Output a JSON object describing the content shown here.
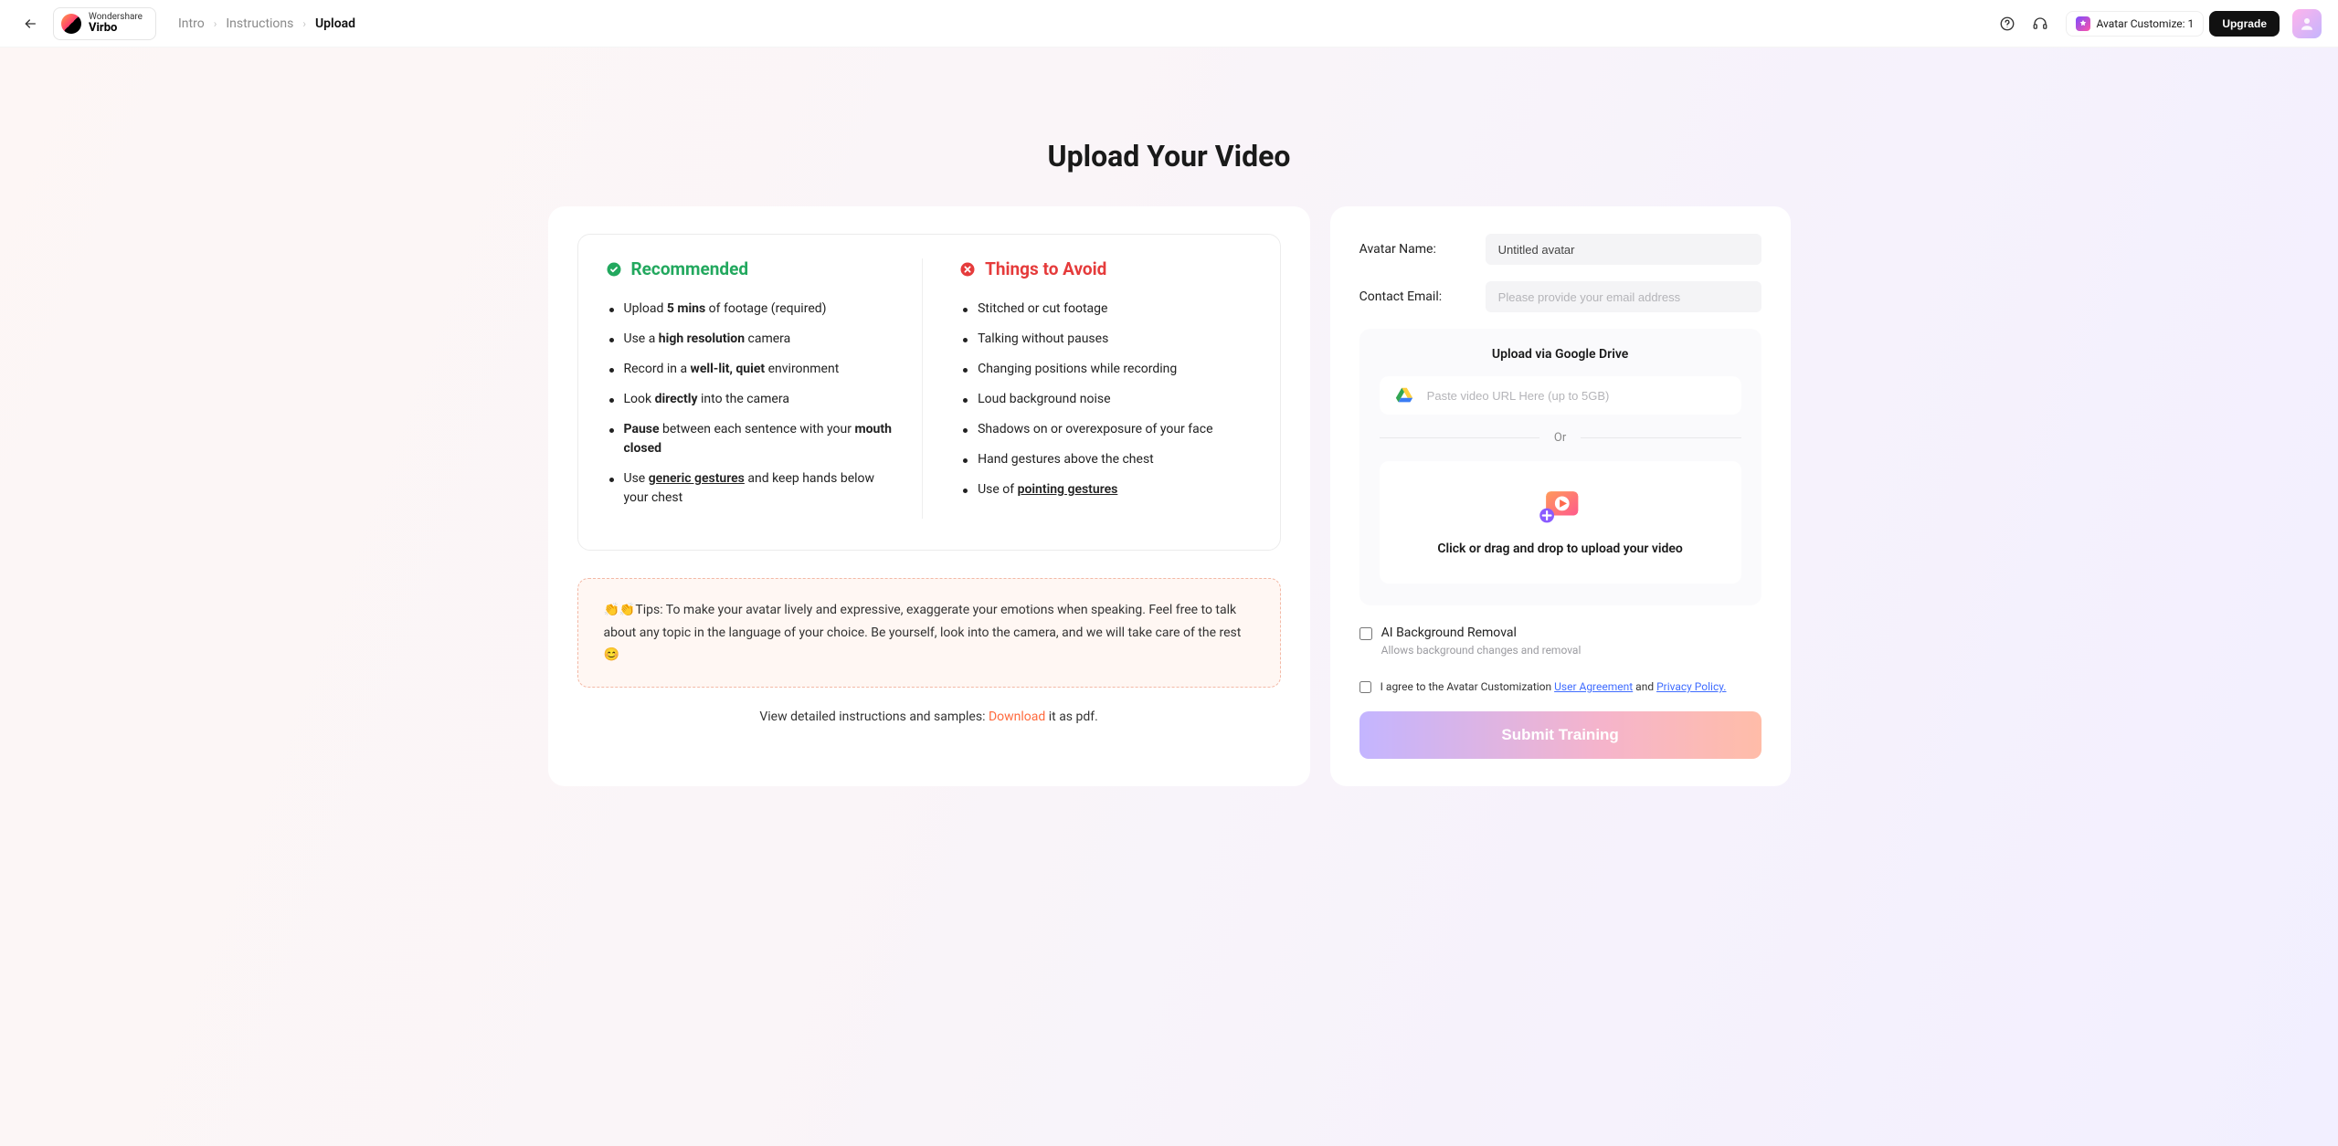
{
  "brand": {
    "top": "Wondershare",
    "bottom": "Virbo"
  },
  "breadcrumb": [
    {
      "label": "Intro",
      "current": false
    },
    {
      "label": "Instructions",
      "current": false
    },
    {
      "label": "Upload",
      "current": true
    }
  ],
  "header": {
    "avatar_customize_label": "Avatar Customize: 1",
    "upgrade": "Upgrade"
  },
  "page": {
    "title": "Upload Your Video"
  },
  "guidelines": {
    "recommended": {
      "heading": "Recommended",
      "items": [
        {
          "html": "Upload <strong>5 mins</strong> of footage (required)"
        },
        {
          "html": "Use a <strong>high resolution</strong> camera"
        },
        {
          "html": "Record in a <strong>well-lit, quiet</strong> environment"
        },
        {
          "html": "Look <strong>directly</strong> into the camera"
        },
        {
          "html": "<strong>Pause</strong> between each sentence with your <strong>mouth closed</strong>"
        },
        {
          "html": "Use <span class='bul'>generic gestures</span> and keep hands below your chest"
        }
      ]
    },
    "avoid": {
      "heading": "Things to Avoid",
      "items": [
        {
          "html": "Stitched or cut footage"
        },
        {
          "html": "Talking without pauses"
        },
        {
          "html": "Changing positions while recording"
        },
        {
          "html": "Loud background noise"
        },
        {
          "html": "Shadows on or overexposure of your face"
        },
        {
          "html": "Hand gestures above the chest"
        },
        {
          "html": "Use of <span class='bul'>pointing gestures</span>"
        }
      ]
    }
  },
  "tips": {
    "text": "👏👏Tips: To make your avatar lively and expressive, exaggerate your emotions when speaking. Feel free to talk about any topic in the language of your choice. Be yourself, look into the camera, and we will take care of the rest 😊"
  },
  "download": {
    "prefix": "View detailed instructions and samples: ",
    "link": "Download",
    "suffix": " it as pdf."
  },
  "form": {
    "avatar_name_label": "Avatar Name:",
    "avatar_name_value": "Untitled avatar",
    "contact_email_label": "Contact Email:",
    "contact_email_placeholder": "Please provide your email address",
    "upload_subtitle": "Upload via Google Drive",
    "gdrive_placeholder": "Paste video URL Here (up to 5GB)",
    "or": "Or",
    "drop_text": "Click or drag and drop to upload your video",
    "bg_removal_label": "AI Background Removal",
    "bg_removal_sub": "Allows background changes and removal",
    "agree_prefix": "I agree to the Avatar Customization ",
    "agree_link1": "User Agreement",
    "agree_mid": " and ",
    "agree_link2": "Privacy Policy.",
    "submit": "Submit Training"
  }
}
